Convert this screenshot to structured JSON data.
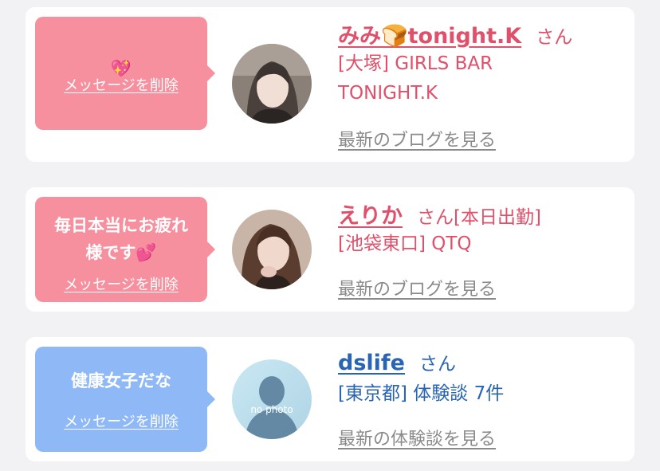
{
  "cards": [
    {
      "message": "💖",
      "delete_label": "メッセージを削除",
      "name": "みみ🍞tonight.K",
      "honorific": "さん",
      "info_lines": [
        "[大塚] GIRLS BAR",
        "TONIGHT.K"
      ],
      "link_label": "最新のブログを見る",
      "color": "#e0506a",
      "bubble_color": "#f6909e"
    },
    {
      "message_line1": "毎日本当にお疲れ",
      "message_line2": "様です💕",
      "delete_label": "メッセージを削除",
      "name": "えりか",
      "honorific": "さん[本日出勤]",
      "info_lines": [
        "[池袋東口] QTQ"
      ],
      "link_label": "最新のブログを見る",
      "color": "#e0506a",
      "bubble_color": "#f6909e"
    },
    {
      "message": "健康女子だな",
      "delete_label": "メッセージを削除",
      "name": "dslife",
      "honorific": "さん",
      "info_lines": [
        "[東京都] 体験談 7件"
      ],
      "link_label": "最新の体験談を見る",
      "avatar_text": "no photo",
      "color": "#2a64b4",
      "bubble_color": "#8fb9f6"
    }
  ]
}
